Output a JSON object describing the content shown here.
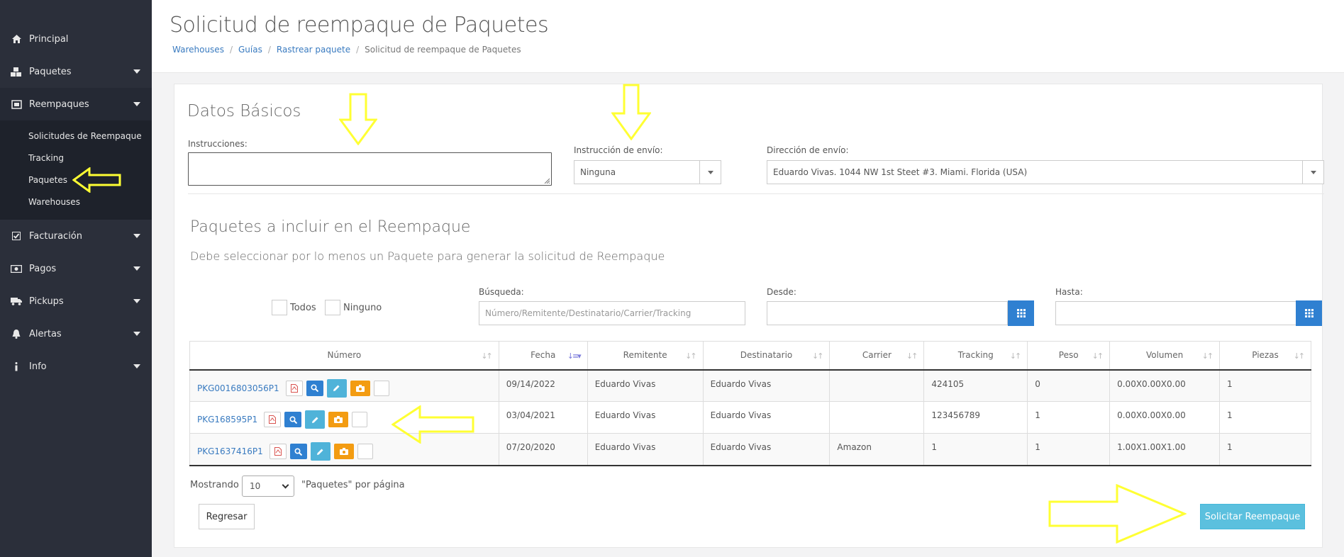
{
  "sidebar": {
    "items": [
      {
        "label": "Principal"
      },
      {
        "label": "Paquetes"
      },
      {
        "label": "Reempaques"
      },
      {
        "label": "Facturación"
      },
      {
        "label": "Pagos"
      },
      {
        "label": "Pickups"
      },
      {
        "label": "Alertas"
      },
      {
        "label": "Info"
      }
    ],
    "sub_items": [
      {
        "label": "Solicitudes de Reempaque"
      },
      {
        "label": "Tracking"
      },
      {
        "label": "Paquetes"
      },
      {
        "label": "Warehouses"
      }
    ]
  },
  "header": {
    "title": "Solicitud de reempaque de Paquetes",
    "breadcrumb": [
      "Warehouses",
      "Guías",
      "Rastrear paquete",
      "Solicitud de reempaque de Paquetes"
    ]
  },
  "basic": {
    "title": "Datos Básicos",
    "instructions_label": "Instrucciones:",
    "instructions_value": "",
    "shipping_instruction_label": "Instrucción de envío:",
    "shipping_instruction_value": "Ninguna",
    "shipping_address_label": "Dirección de envío:",
    "shipping_address_value": "Eduardo Vivas. 1044 NW 1st Steet #3. Miami. Florida (USA)"
  },
  "packages": {
    "title": "Paquetes a incluir en el Reempaque",
    "subtitle": "Debe seleccionar por lo menos un Paquete para generar la solicitud de Reempaque",
    "select_all_label": "Todos",
    "select_none_label": "Ninguno",
    "search_label": "Búsqueda:",
    "search_placeholder": "Número/Remitente/Destinatario/Carrier/Tracking",
    "from_label": "Desde:",
    "to_label": "Hasta:",
    "columns": [
      "Número",
      "Fecha",
      "Remitente",
      "Destinatario",
      "Carrier",
      "Tracking",
      "Peso",
      "Volumen",
      "Piezas"
    ],
    "rows": [
      {
        "numero": "PKG0016803056P1",
        "fecha": "09/14/2022",
        "remitente": "Eduardo Vivas",
        "destinatario": "Eduardo Vivas",
        "carrier": "",
        "tracking": "424105",
        "peso": "0",
        "volumen": "0.00X0.00X0.00",
        "piezas": "1"
      },
      {
        "numero": "PKG168595P1",
        "fecha": "03/04/2021",
        "remitente": "Eduardo Vivas",
        "destinatario": "Eduardo Vivas",
        "carrier": "",
        "tracking": "123456789",
        "peso": "1",
        "volumen": "0.00X0.00X0.00",
        "piezas": "1"
      },
      {
        "numero": "PKG1637416P1",
        "fecha": "07/20/2020",
        "remitente": "Eduardo Vivas",
        "destinatario": "Eduardo Vivas",
        "carrier": "Amazon",
        "tracking": "1",
        "peso": "1",
        "volumen": "1.00X1.00X1.00",
        "piezas": "1"
      }
    ]
  },
  "footer": {
    "showing_label": "Mostrando",
    "per_page_value": "10",
    "per_page_suffix": "\"Paquetes\" por página",
    "back_button": "Regresar",
    "submit_button": "Solicitar Reempaque"
  },
  "colors": {
    "sidebar_bg": "#2b2f3a",
    "link": "#3a7bc0",
    "primary_button": "#5bc0de",
    "annotation_arrow": "#ffff33"
  }
}
